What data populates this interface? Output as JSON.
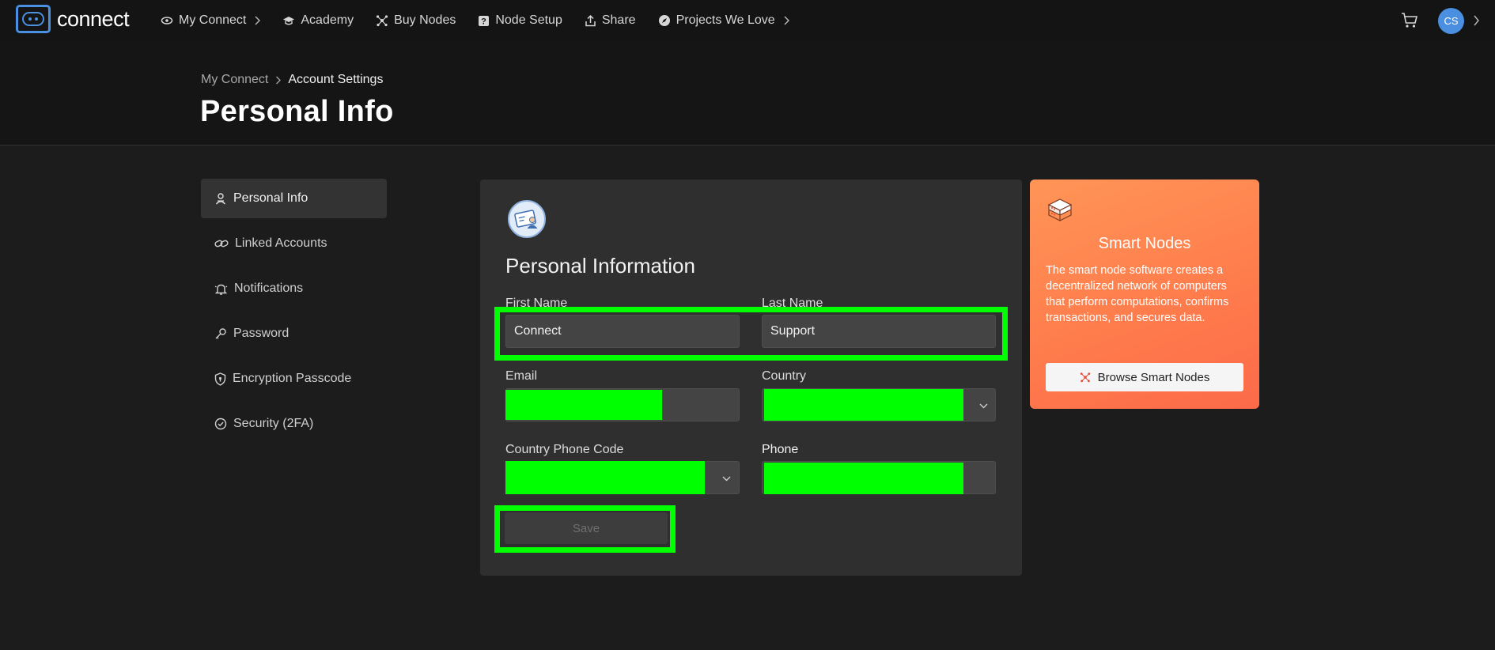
{
  "app": {
    "logo_text": "connect"
  },
  "nav": {
    "items": [
      {
        "label": "My Connect",
        "icon": "eye-icon",
        "has_chevron": true
      },
      {
        "label": "Academy",
        "icon": "graduation-cap-icon",
        "has_chevron": false
      },
      {
        "label": "Buy Nodes",
        "icon": "nodes-icon",
        "has_chevron": false
      },
      {
        "label": "Node Setup",
        "icon": "help-square-icon",
        "has_chevron": false
      },
      {
        "label": "Share",
        "icon": "share-icon",
        "has_chevron": false
      },
      {
        "label": "Projects We Love",
        "icon": "compass-icon",
        "has_chevron": true
      }
    ],
    "cart_icon": "cart-icon",
    "avatar_initials": "CS"
  },
  "breadcrumb": {
    "parent": "My Connect",
    "current": "Account Settings"
  },
  "page_title": "Personal Info",
  "sidebar": {
    "items": [
      {
        "label": "Personal Info",
        "icon": "person-icon",
        "active": true
      },
      {
        "label": "Linked Accounts",
        "icon": "link-icon",
        "active": false
      },
      {
        "label": "Notifications",
        "icon": "bell-icon",
        "active": false
      },
      {
        "label": "Password",
        "icon": "key-icon",
        "active": false
      },
      {
        "label": "Encryption Passcode",
        "icon": "shield-icon",
        "active": false
      },
      {
        "label": "Security (2FA)",
        "icon": "check-circle-icon",
        "active": false
      }
    ]
  },
  "form": {
    "title": "Personal Information",
    "first_name": {
      "label": "First Name",
      "value": "Connect"
    },
    "last_name": {
      "label": "Last Name",
      "value": "Support"
    },
    "email": {
      "label": "Email"
    },
    "country": {
      "label": "Country"
    },
    "country_phone_code": {
      "label": "Country Phone Code"
    },
    "phone": {
      "label": "Phone"
    },
    "save_label": "Save"
  },
  "promo": {
    "title": "Smart Nodes",
    "text": "The smart node software creates a decentralized network of computers that perform computations, confirms transactions, and secures data.",
    "button_label": "Browse Smart Nodes"
  },
  "colors": {
    "accent_blue": "#4a8fe0",
    "highlight_green": "#00ff00",
    "promo_orange": "#ff8550",
    "background": "#1c1c1c"
  }
}
